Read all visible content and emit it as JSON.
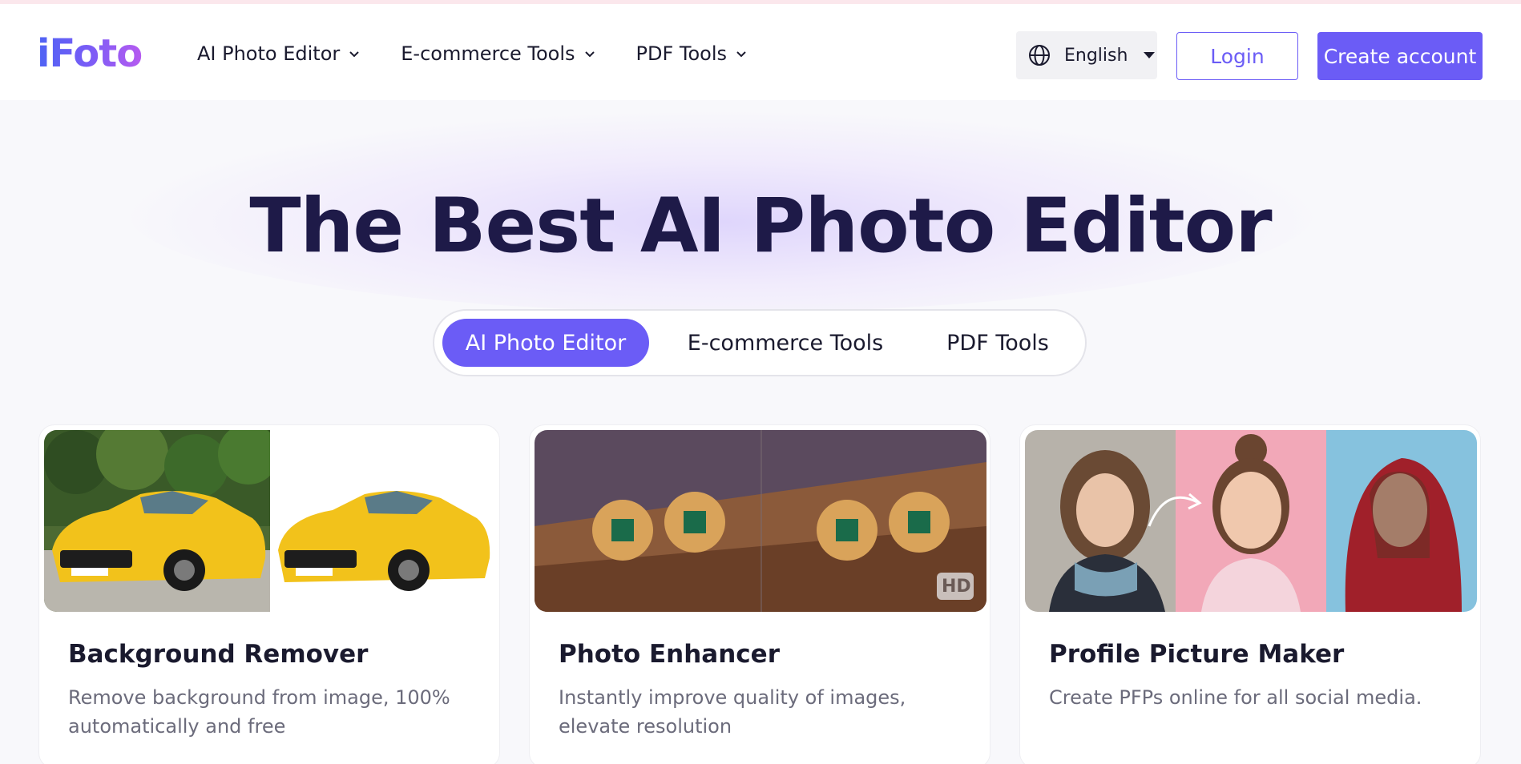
{
  "header": {
    "logo_text": "iFoto",
    "nav": [
      {
        "label": "AI Photo Editor"
      },
      {
        "label": "E-commerce Tools"
      },
      {
        "label": "PDF Tools"
      }
    ],
    "language": "English",
    "login_label": "Login",
    "create_label": "Create account"
  },
  "hero": {
    "title": "The Best AI Photo Editor",
    "tabs": [
      {
        "label": "AI Photo Editor",
        "active": true
      },
      {
        "label": "E-commerce Tools",
        "active": false
      },
      {
        "label": "PDF Tools",
        "active": false
      }
    ]
  },
  "cards": [
    {
      "title": "Background Remover",
      "desc": "Remove background from image, 100% automatically and free"
    },
    {
      "title": "Photo Enhancer",
      "desc": "Instantly improve quality of images, elevate resolution",
      "badge": "HD"
    },
    {
      "title": "Profile Picture Maker",
      "desc": "Create PFPs online for all social media."
    }
  ],
  "colors": {
    "accent": "#6b5cf6",
    "title": "#1e1a48"
  }
}
